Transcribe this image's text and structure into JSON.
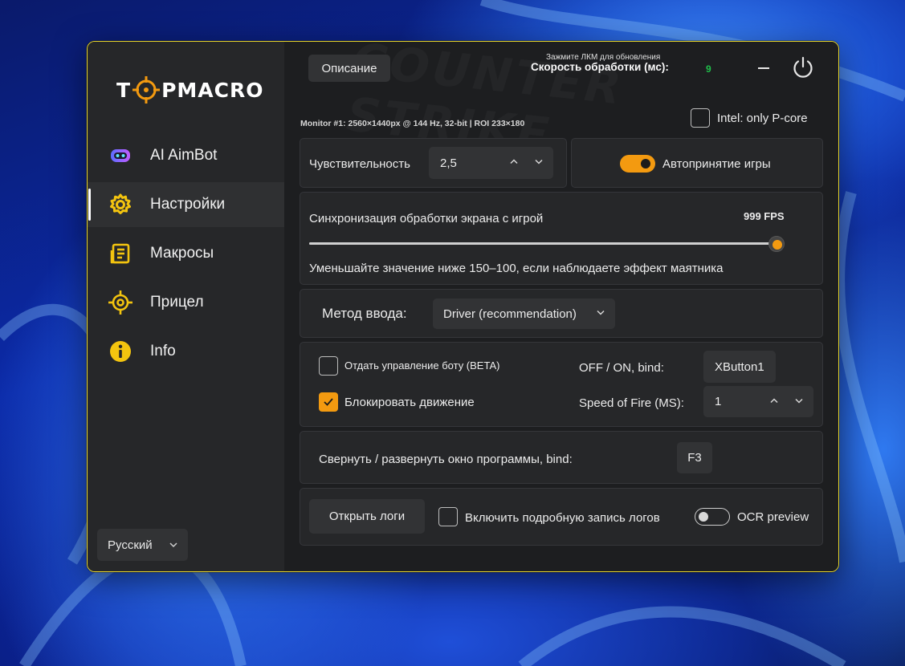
{
  "app": {
    "logo_text_left": "T",
    "logo_text_right": "PMACRO"
  },
  "sidebar": {
    "items": [
      {
        "label": "AI AimBot",
        "icon": "robot-icon"
      },
      {
        "label": "Настройки",
        "icon": "gear-icon"
      },
      {
        "label": "Макросы",
        "icon": "document-icon"
      },
      {
        "label": "Прицел",
        "icon": "crosshair-icon"
      },
      {
        "label": "Info",
        "icon": "info-icon"
      }
    ],
    "active_index": 1,
    "language": "Русский"
  },
  "header": {
    "description_button": "Описание",
    "hint": "Зажмите ЛКМ для обновления",
    "speed_label": "Скорость обработки (мс):",
    "speed_value": "9",
    "monitor_info": "Monitor #1: 2560×1440px @ 144 Hz, 32-bit | ROI 233×180",
    "intel_checkbox_label": "Intel: only P-core",
    "intel_checked": false
  },
  "sensitivity": {
    "label": "Чувствительность",
    "value": "2,5"
  },
  "auto_accept": {
    "label": "Автопринятие игры",
    "on": true
  },
  "sync": {
    "label": "Синхронизация обработки экрана с игрой",
    "value_text": "999 FPS",
    "slider_fraction": 1.0,
    "hint": "Уменьшайте значение ниже 150–100, если наблюдаете эффект маятника"
  },
  "input_method": {
    "label": "Метод ввода:",
    "value": "Driver (recommendation)"
  },
  "bot_control": {
    "give_control_label": "Отдать управление боту (BETA)",
    "give_control_checked": false,
    "block_movement_label": "Блокировать движение",
    "block_movement_checked": true,
    "bind_label": "OFF / ON, bind:",
    "bind_value": "XButton1",
    "fire_speed_label": "Speed of Fire (MS):",
    "fire_speed_value": "1"
  },
  "window_toggle": {
    "label": "Свернуть / развернуть окно программы, bind:",
    "bind_value": "F3"
  },
  "logs": {
    "open_button": "Открыть логи",
    "verbose_label": "Включить подробную запись логов",
    "verbose_checked": false,
    "ocr_label": "OCR preview",
    "ocr_on": false
  },
  "colors": {
    "accent": "#f39a10",
    "frame": "#e8d62a",
    "speed_value": "#1fc14a"
  }
}
